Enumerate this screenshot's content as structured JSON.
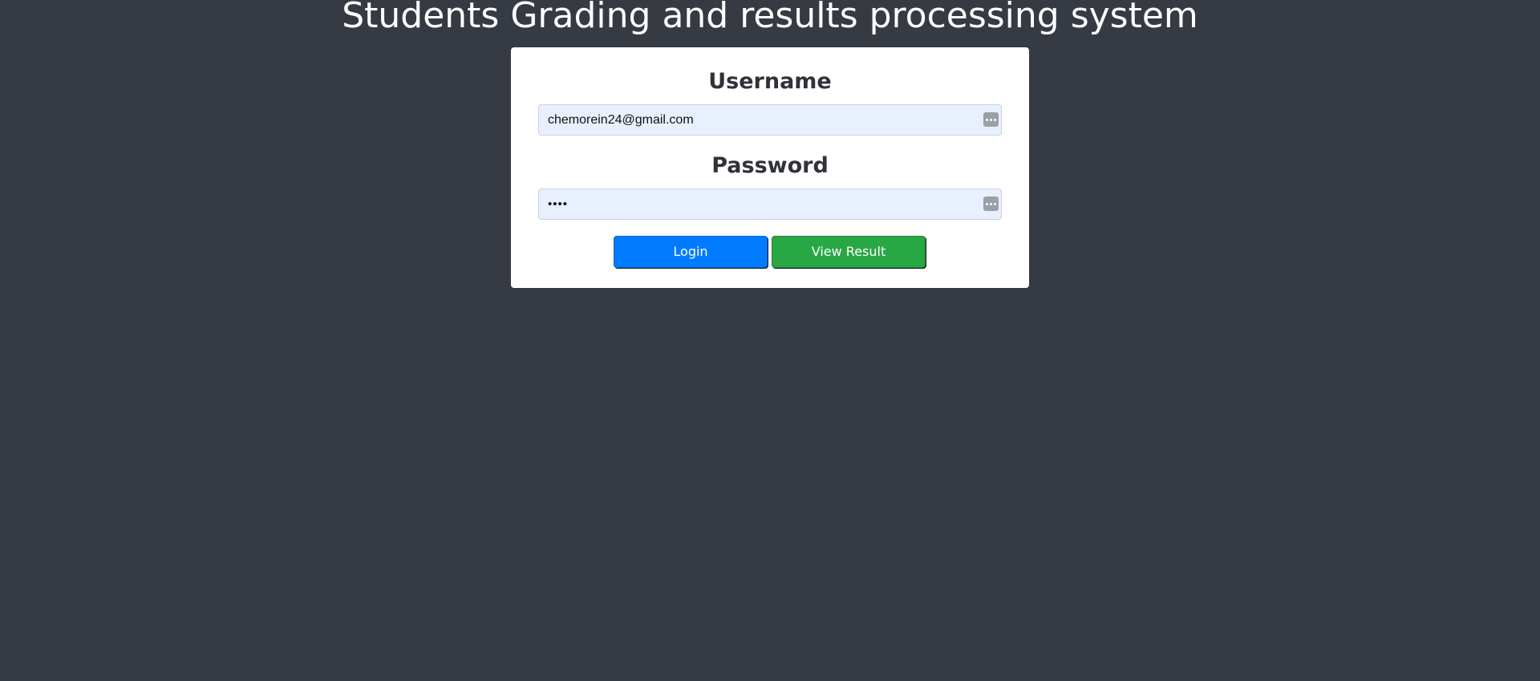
{
  "header": {
    "title": "Students Grading and results processing system"
  },
  "login_form": {
    "username": {
      "label": "Username",
      "value": "chemorein24@gmail.com",
      "autofill_icon": "more-dots-icon"
    },
    "password": {
      "label": "Password",
      "value": "••••",
      "autofill_icon": "more-dots-icon"
    },
    "buttons": {
      "login_label": "Login",
      "view_result_label": "View Result"
    }
  },
  "colors": {
    "background": "#363a42",
    "card": "#ffffff",
    "input_fill": "#e8f0fe",
    "login_button": "#007bff",
    "view_result_button": "#28a745"
  }
}
